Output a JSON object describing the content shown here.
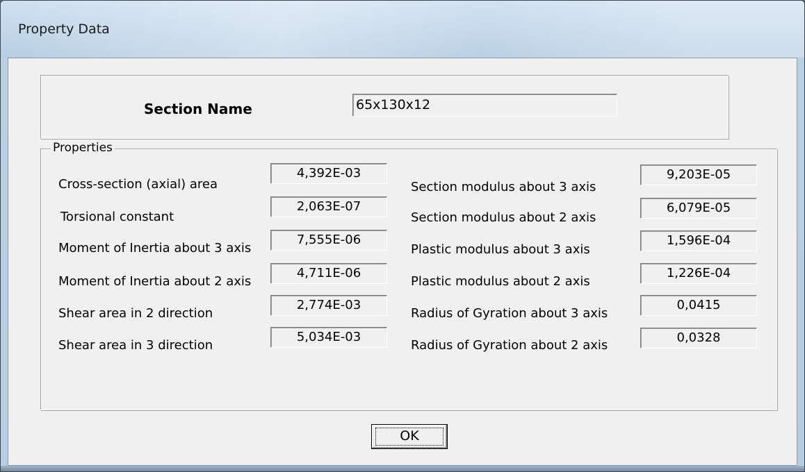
{
  "window": {
    "title": "Property Data"
  },
  "section": {
    "label": "Section Name",
    "value": "65x130x12"
  },
  "properties": {
    "legend": "Properties",
    "left": [
      {
        "label": "Cross-section (axial) area",
        "value": "4,392E-03"
      },
      {
        "label": "Torsional constant",
        "value": "2,063E-07"
      },
      {
        "label": "Moment of Inertia about 3 axis",
        "value": "7,555E-06"
      },
      {
        "label": "Moment of Inertia about 2 axis",
        "value": "4,711E-06"
      },
      {
        "label": "Shear area in 2 direction",
        "value": "2,774E-03"
      },
      {
        "label": "Shear area in 3 direction",
        "value": "5,034E-03"
      }
    ],
    "right": [
      {
        "label": "Section modulus about 3 axis",
        "value": "9,203E-05"
      },
      {
        "label": "Section modulus about 2 axis",
        "value": "6,079E-05"
      },
      {
        "label": "Plastic modulus about 3 axis",
        "value": "1,596E-04"
      },
      {
        "label": "Plastic modulus about 2 axis",
        "value": "1,226E-04"
      },
      {
        "label": "Radius of Gyration about 3 axis",
        "value": "0,0415"
      },
      {
        "label": "Radius of Gyration about 2 axis",
        "value": "0,0328"
      }
    ]
  },
  "buttons": {
    "ok_label": "OK"
  }
}
